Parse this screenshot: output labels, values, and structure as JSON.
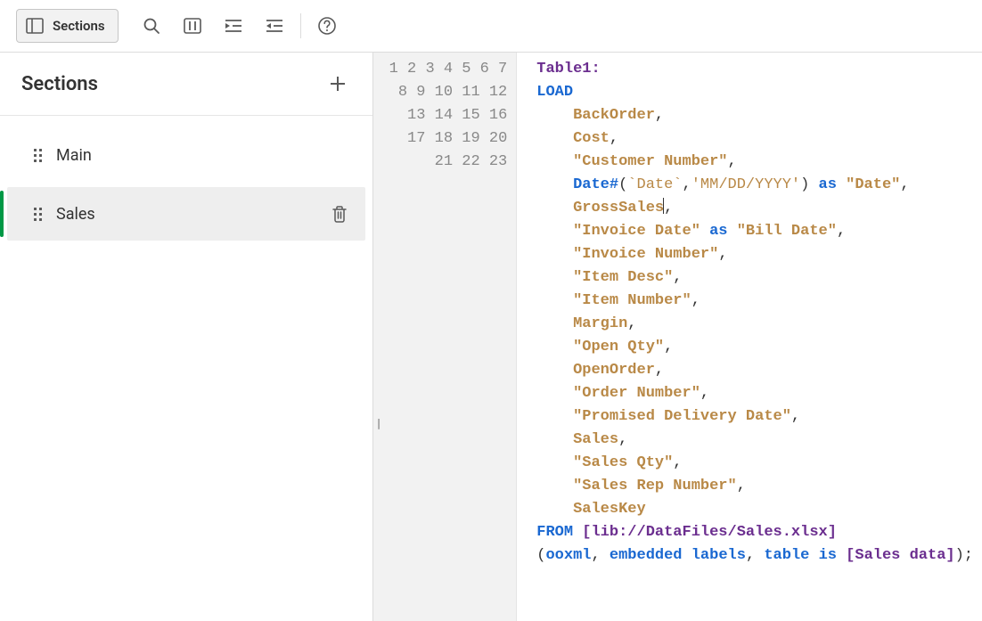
{
  "toolbar": {
    "sections_label": "Sections"
  },
  "sidebar": {
    "title": "Sections",
    "items": [
      {
        "label": "Main",
        "active": false
      },
      {
        "label": "Sales",
        "active": true
      }
    ]
  },
  "editor": {
    "line_count": 23,
    "cursor_line": 7,
    "script": {
      "table_decl": "Table1:",
      "load_kw": "LOAD",
      "fields": [
        {
          "type": "id",
          "name": "BackOrder"
        },
        {
          "type": "id",
          "name": "Cost"
        },
        {
          "type": "str",
          "name": "Customer Number"
        },
        {
          "type": "fn",
          "fn": "Date#",
          "arg_bt": "Date",
          "arg_lit": "MM/DD/YYYY",
          "alias": "Date"
        },
        {
          "type": "id",
          "name": "GrossSales",
          "cursor_after": true
        },
        {
          "type": "str",
          "name": "Invoice Date",
          "alias": "Bill Date"
        },
        {
          "type": "str",
          "name": "Invoice Number"
        },
        {
          "type": "str",
          "name": "Item Desc"
        },
        {
          "type": "str",
          "name": "Item Number"
        },
        {
          "type": "id",
          "name": "Margin"
        },
        {
          "type": "str",
          "name": "Open Qty"
        },
        {
          "type": "id",
          "name": "OpenOrder"
        },
        {
          "type": "str",
          "name": "Order Number"
        },
        {
          "type": "str",
          "name": "Promised Delivery Date"
        },
        {
          "type": "id",
          "name": "Sales"
        },
        {
          "type": "str",
          "name": "Sales Qty"
        },
        {
          "type": "str",
          "name": "Sales Rep Number"
        },
        {
          "type": "id",
          "name": "SalesKey",
          "last": true
        }
      ],
      "from_kw": "FROM",
      "from_path": "lib://DataFiles/Sales.xlsx",
      "spec": {
        "ooxml": "ooxml",
        "embedded": "embedded",
        "labels": "labels",
        "table_kw": "table",
        "is_kw": "is",
        "table_name": "Sales data"
      }
    }
  }
}
